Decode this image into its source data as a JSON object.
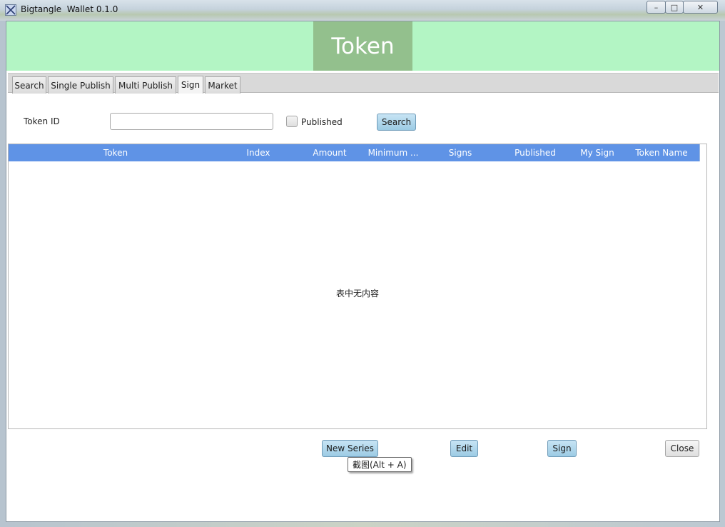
{
  "window": {
    "title": "Bigtangle  Wallet 0.1.0",
    "controls": {
      "minimize": "–",
      "maximize": "□",
      "close": "✕"
    }
  },
  "banner": {
    "title": "Token",
    "color": "#b3f5c4",
    "title_bg": "#93c08d"
  },
  "tabs": [
    {
      "label": "Search",
      "active": false
    },
    {
      "label": "Single Publish",
      "active": false
    },
    {
      "label": "Multi Publish",
      "active": false
    },
    {
      "label": "Sign",
      "active": true
    },
    {
      "label": "Market",
      "active": false
    }
  ],
  "search_form": {
    "token_id_label": "Token ID",
    "token_id_value": "",
    "published_label": "Published",
    "published_checked": false,
    "search_button": "Search"
  },
  "table": {
    "header_color": "#5f93e6",
    "columns": [
      "Token",
      "Index",
      "Amount",
      "Minimum ...",
      "Signs",
      "Published",
      "My Sign",
      "Token Name"
    ],
    "rows": [],
    "empty_text": "表中无内容"
  },
  "actions": {
    "new_series": "New Series",
    "edit": "Edit",
    "sign": "Sign",
    "close": "Close"
  },
  "tooltip": {
    "text": "截图(Alt + A)"
  }
}
